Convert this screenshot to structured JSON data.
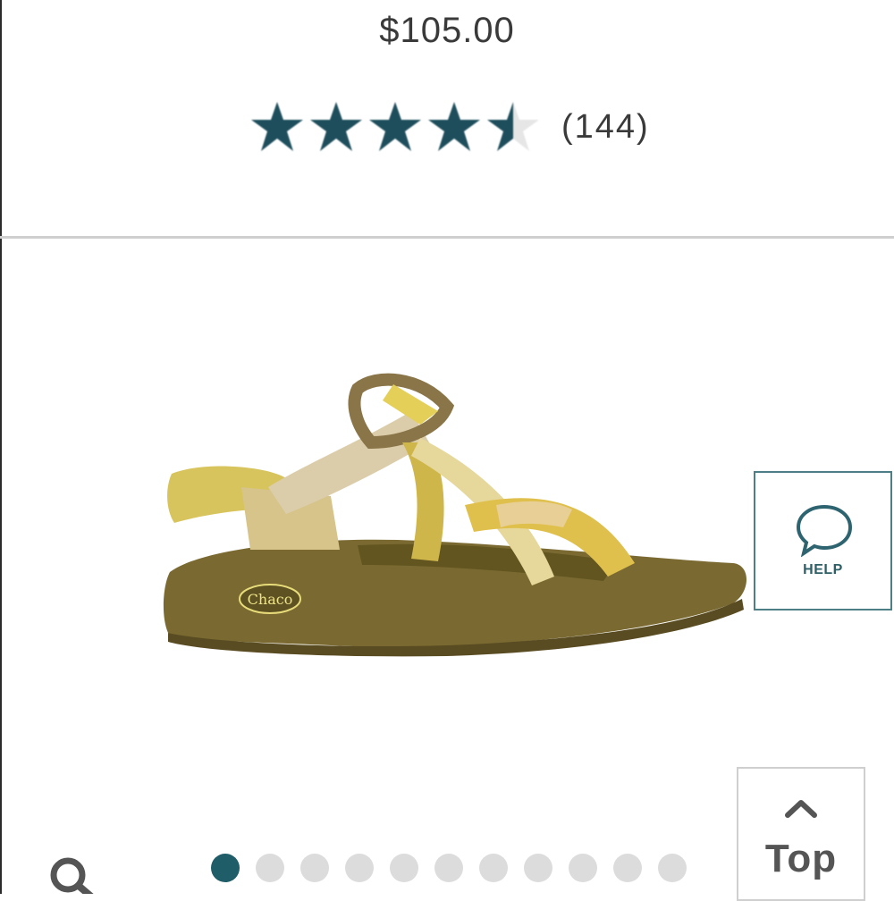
{
  "product": {
    "price": "$105.00",
    "rating_value": 4.5,
    "rating_max": 5,
    "review_count": "(144)",
    "image_alt": "sandal product image"
  },
  "help": {
    "label": "HELP",
    "icon": "chat-bubble-icon"
  },
  "scroll_top": {
    "label": "Top",
    "icon": "chevron-up-icon"
  },
  "search": {
    "icon": "search-icon"
  },
  "gallery": {
    "total_images": 11,
    "active_index": 0
  },
  "colors": {
    "star": "#1e4e5c",
    "accent": "#1f5d68",
    "help_border": "#4d7f86",
    "dot_inactive": "#dcdcdc",
    "divider": "#cfcfcf"
  }
}
